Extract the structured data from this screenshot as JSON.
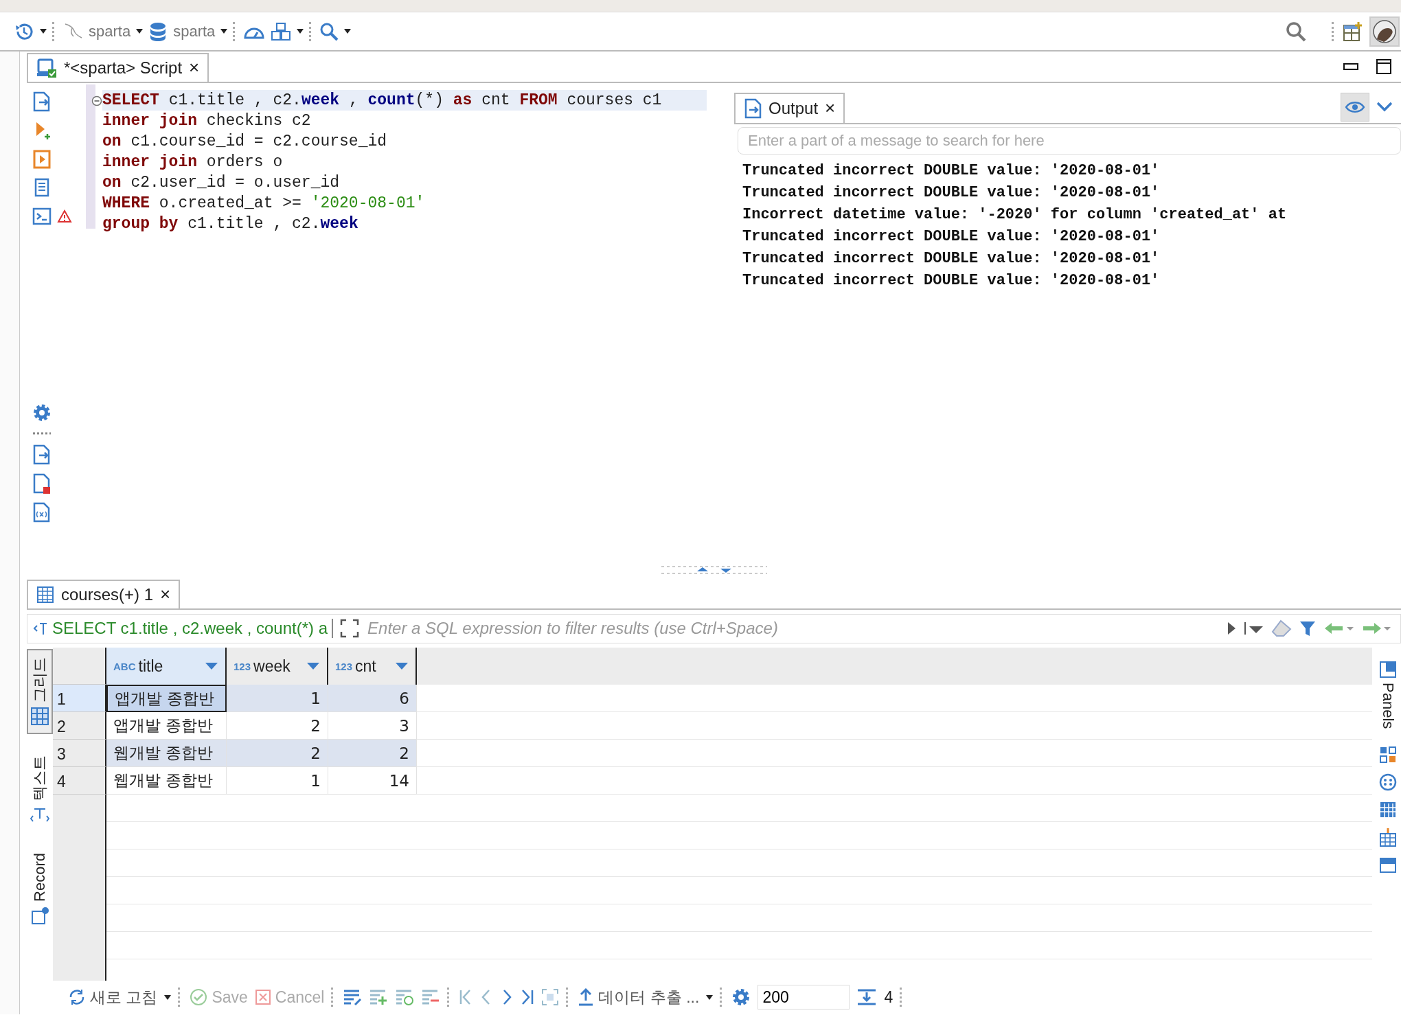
{
  "toolbar": {
    "connection": "sparta",
    "database": "sparta"
  },
  "editor": {
    "tab": {
      "title": "*<sparta> Script",
      "close": "×",
      "selected": true
    },
    "lines": [
      [
        {
          "kind": "keyword",
          "text": "SELECT"
        },
        {
          "kind": "plain",
          "text": " c1.title , c2."
        },
        {
          "kind": "column",
          "text": "week"
        },
        {
          "kind": "plain",
          "text": " , "
        },
        {
          "kind": "column",
          "text": "count"
        },
        {
          "kind": "plain",
          "text": "(*) "
        },
        {
          "kind": "keyword",
          "text": "as"
        },
        {
          "kind": "plain",
          "text": " cnt "
        },
        {
          "kind": "keyword",
          "text": "FROM"
        },
        {
          "kind": "plain",
          "text": " courses c1"
        }
      ],
      [
        {
          "kind": "keyword",
          "text": "inner join"
        },
        {
          "kind": "plain",
          "text": " checkins c2"
        }
      ],
      [
        {
          "kind": "keyword",
          "text": "on"
        },
        {
          "kind": "plain",
          "text": " c1.course_id = c2.course_id"
        }
      ],
      [
        {
          "kind": "keyword",
          "text": "inner join"
        },
        {
          "kind": "plain",
          "text": " orders o"
        }
      ],
      [
        {
          "kind": "keyword",
          "text": "on"
        },
        {
          "kind": "plain",
          "text": " c2.user_id = o.user_id"
        }
      ],
      [
        {
          "kind": "keyword",
          "text": "WHERE"
        },
        {
          "kind": "plain",
          "text": " o.created_at >= "
        },
        {
          "kind": "string",
          "text": "'2020-08-01'"
        }
      ],
      [
        {
          "kind": "keyword",
          "text": "group by"
        },
        {
          "kind": "plain",
          "text": " c1.title , c2."
        },
        {
          "kind": "column",
          "text": "week"
        }
      ]
    ]
  },
  "output": {
    "tab": {
      "title": "Output",
      "close": "×",
      "selected": true
    },
    "placeholder": "Enter a part of a message to search for here",
    "lines": [
      "Truncated incorrect DOUBLE value: '2020-08-01'",
      "Truncated incorrect DOUBLE value: '2020-08-01'",
      "Incorrect datetime value: '-2020' for column 'created_at' at",
      "Truncated incorrect DOUBLE value: '2020-08-01'",
      "Truncated incorrect DOUBLE value: '2020-08-01'",
      "Truncated incorrect DOUBLE value: '2020-08-01'"
    ]
  },
  "results": {
    "tab": {
      "title": "courses(+) 1",
      "close": "×",
      "selected": true
    },
    "query": "SELECT c1.title , c2.week , count(*) a",
    "placeholder": "Enter a SQL expression to filter results (use Ctrl+Space)",
    "view_tabs": [
      {
        "label": "그리드",
        "selected": true
      },
      {
        "label": "텍스트",
        "selected": false
      },
      {
        "label": "Record",
        "selected": false
      }
    ],
    "side_panel": "Panels",
    "columns": [
      {
        "name": "title",
        "type_label": "ABC",
        "kind": "text"
      },
      {
        "name": "week",
        "type_label": "123",
        "kind": "number"
      },
      {
        "name": "cnt",
        "type_label": "123",
        "kind": "number"
      }
    ],
    "rows": [
      {
        "number": "1",
        "cells": [
          "앱개발 종합반",
          "1",
          "6"
        ],
        "selected": true
      },
      {
        "number": "2",
        "cells": [
          "앱개발 종합반",
          "2",
          "3"
        ],
        "selected": false
      },
      {
        "number": "3",
        "cells": [
          "웹개발 종합반",
          "2",
          "2"
        ],
        "selected": false
      },
      {
        "number": "4",
        "cells": [
          "웹개발 종합반",
          "1",
          "14"
        ],
        "selected": false
      }
    ]
  },
  "bottom_bar": {
    "refresh": "새로 고침",
    "save": {
      "label": "Save",
      "disabled": true
    },
    "cancel": {
      "label": "Cancel",
      "disabled": true
    },
    "export": "데이터 추출 ...",
    "fetch_size": "200",
    "row_count": "4"
  }
}
